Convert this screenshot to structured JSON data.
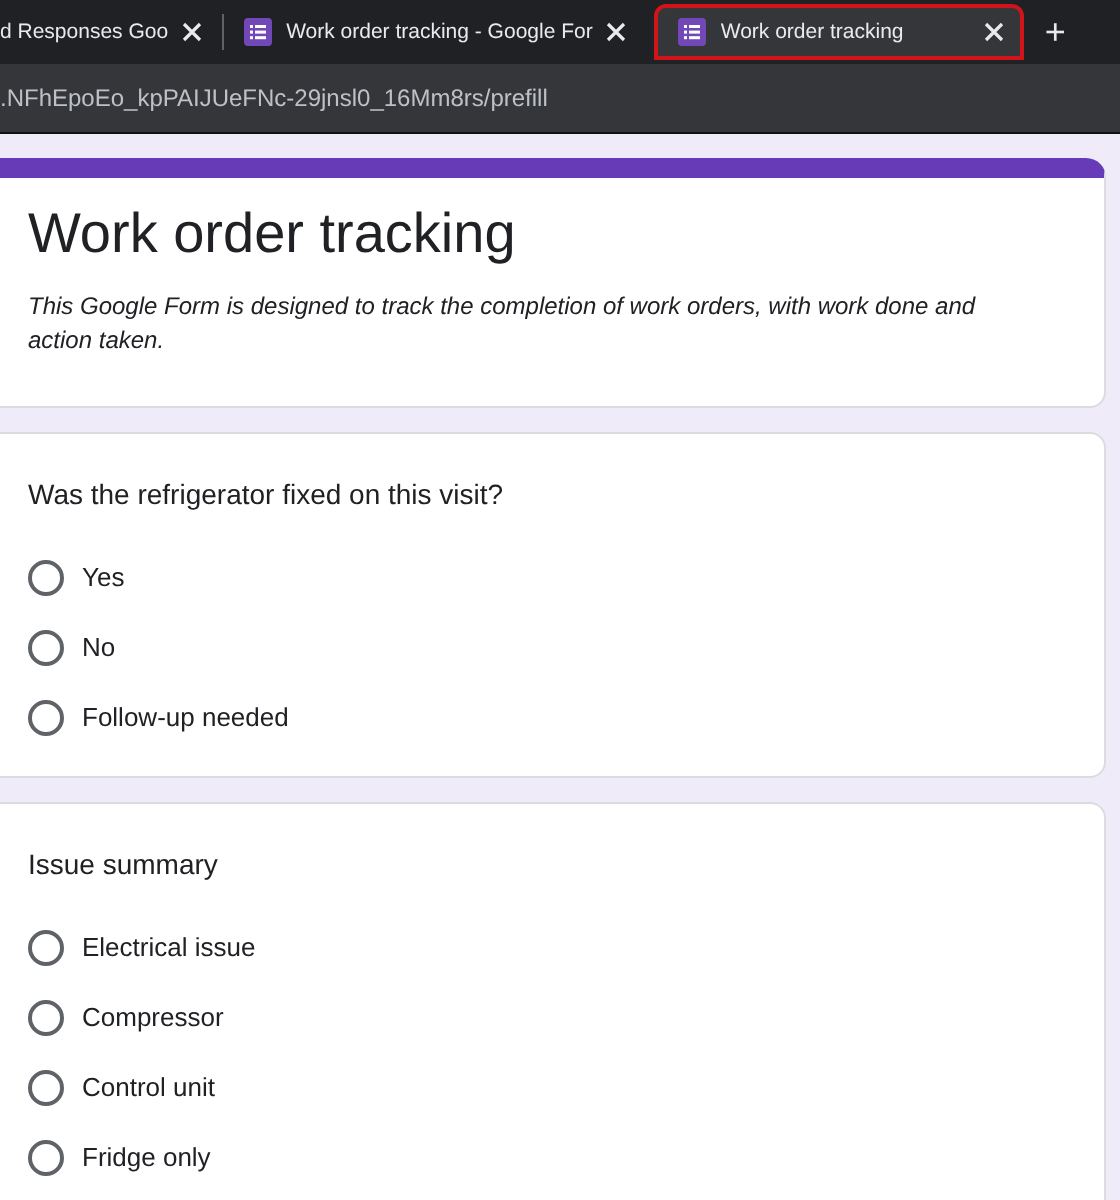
{
  "tabs": [
    {
      "title": "d Responses Goo",
      "icon": false,
      "selected": false
    },
    {
      "title": "Work order tracking - Google For",
      "icon": true,
      "selected": false
    },
    {
      "title": "Work order tracking",
      "icon": true,
      "selected": true
    }
  ],
  "new_tab": "+",
  "address_bar": {
    "url": ".NFhEpoEo_kpPAIJUeFNc-29jnsl0_16Mm8rs/prefill"
  },
  "form": {
    "title": "Work order tracking",
    "description": "This Google Form is designed to track the completion of work orders, with work done and action taken."
  },
  "questions": [
    {
      "title": "Was the refrigerator fixed on this visit?",
      "options": [
        {
          "label": "Yes",
          "selected": false
        },
        {
          "label": "No",
          "selected": false
        },
        {
          "label": "Follow-up needed",
          "selected": false
        }
      ]
    },
    {
      "title": "Issue summary",
      "options": [
        {
          "label": "Electrical issue",
          "selected": false
        },
        {
          "label": "Compressor",
          "selected": false
        },
        {
          "label": "Control unit",
          "selected": false
        },
        {
          "label": "Fridge only",
          "selected": false
        }
      ]
    }
  ]
}
